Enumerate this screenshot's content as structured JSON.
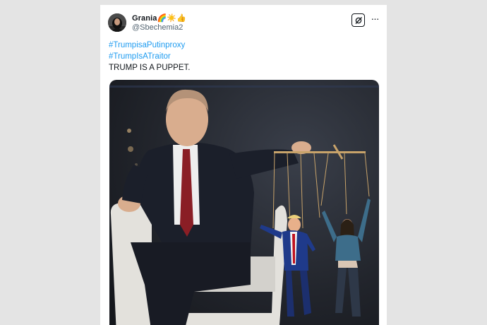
{
  "tweet": {
    "author": {
      "display_name": "Grania",
      "name_emojis": "🌈☀️👍",
      "handle": "@Sbechemia2",
      "avatar_icon": "profile-avatar"
    },
    "hashtags": [
      "#TrumpisaPutinproxy",
      "#TrumpIsATraitor"
    ],
    "text": "TRUMP  IS A PUPPET.",
    "actions": {
      "grok_icon": "grok-icon",
      "more_icon": "more-options-icon",
      "more_label": "···"
    },
    "media_alt": "puppeteer-image"
  },
  "colors": {
    "link": "#1d9bf0",
    "text": "#0f1419",
    "secondary": "#536471"
  }
}
